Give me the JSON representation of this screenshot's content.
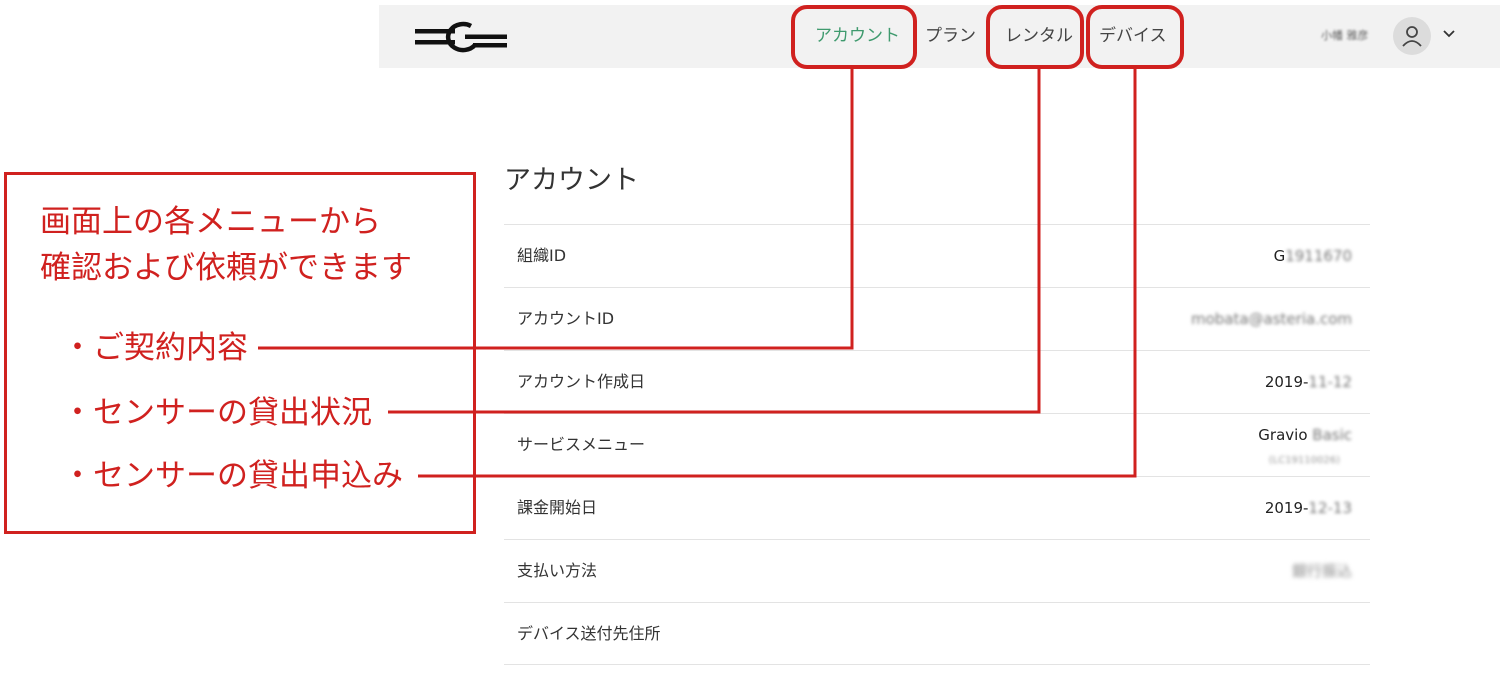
{
  "header": {
    "nav": [
      {
        "label": "アカウント",
        "active": true
      },
      {
        "label": "プラン",
        "active": false
      },
      {
        "label": "レンタル",
        "active": false
      },
      {
        "label": "デバイス",
        "active": false
      }
    ],
    "user": {
      "name": "小幡 雅彦",
      "icon": "user-icon",
      "menu_icon": "chevron-down-icon"
    }
  },
  "page": {
    "title": "アカウント"
  },
  "account_info": [
    {
      "label": "組織ID",
      "value_visible": "G",
      "value_obscured": "1911670"
    },
    {
      "label": "アカウントID",
      "value_visible": "",
      "value_obscured": "mobata@asteria.com"
    },
    {
      "label": "アカウント作成日",
      "value_visible": "2019-",
      "value_obscured": "11-12"
    },
    {
      "label": "サービスメニュー",
      "value_visible": "Gravio ",
      "value_obscured": "Basic",
      "sub_obscured": "(LC19110026)"
    },
    {
      "label": "課金開始日",
      "value_visible": "2019-",
      "value_obscured": "12-13"
    },
    {
      "label": "支払い方法",
      "value_visible": "",
      "value_obscured": "銀行振込"
    },
    {
      "label": "デバイス送付先住所",
      "value_visible": "",
      "value_obscured": ""
    }
  ],
  "annotation": {
    "heading_lines": [
      "画面上の各メニューから",
      "確認および依頼ができます"
    ],
    "bullets": [
      "・ご契約内容",
      "・センサーの貸出状況",
      "・センサーの貸出申込み"
    ]
  },
  "colors": {
    "accent_green": "#3f9a6e",
    "annotation_red": "#d0211f",
    "header_bg": "#f2f2f2"
  }
}
